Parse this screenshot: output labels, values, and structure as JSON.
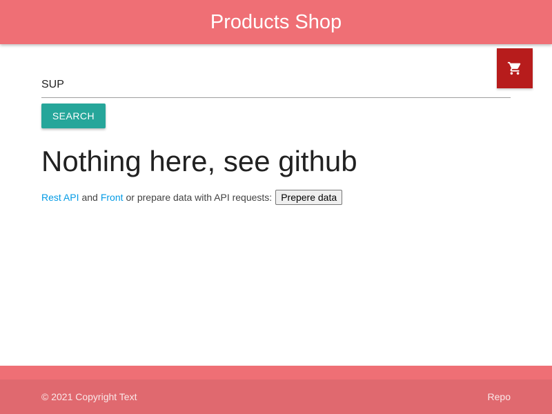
{
  "navbar": {
    "brand": "Products Shop"
  },
  "cart": {
    "icon": "shopping-cart-icon",
    "color": "#b71c1c"
  },
  "search": {
    "value": "SUP",
    "button_label": "SEARCH"
  },
  "main": {
    "heading": "Nothing here, see github",
    "link_rest_api": "Rest API",
    "text_and": "and",
    "link_front": "Front",
    "text_prepare": "or prepare data with API requests:",
    "prepare_button": "Prepere data"
  },
  "footer": {
    "copyright": "© 2021 Copyright Text",
    "repo_link": "Repo"
  },
  "colors": {
    "navbar": "#ef6f75",
    "accent": "#26a69a",
    "link": "#039be5"
  }
}
